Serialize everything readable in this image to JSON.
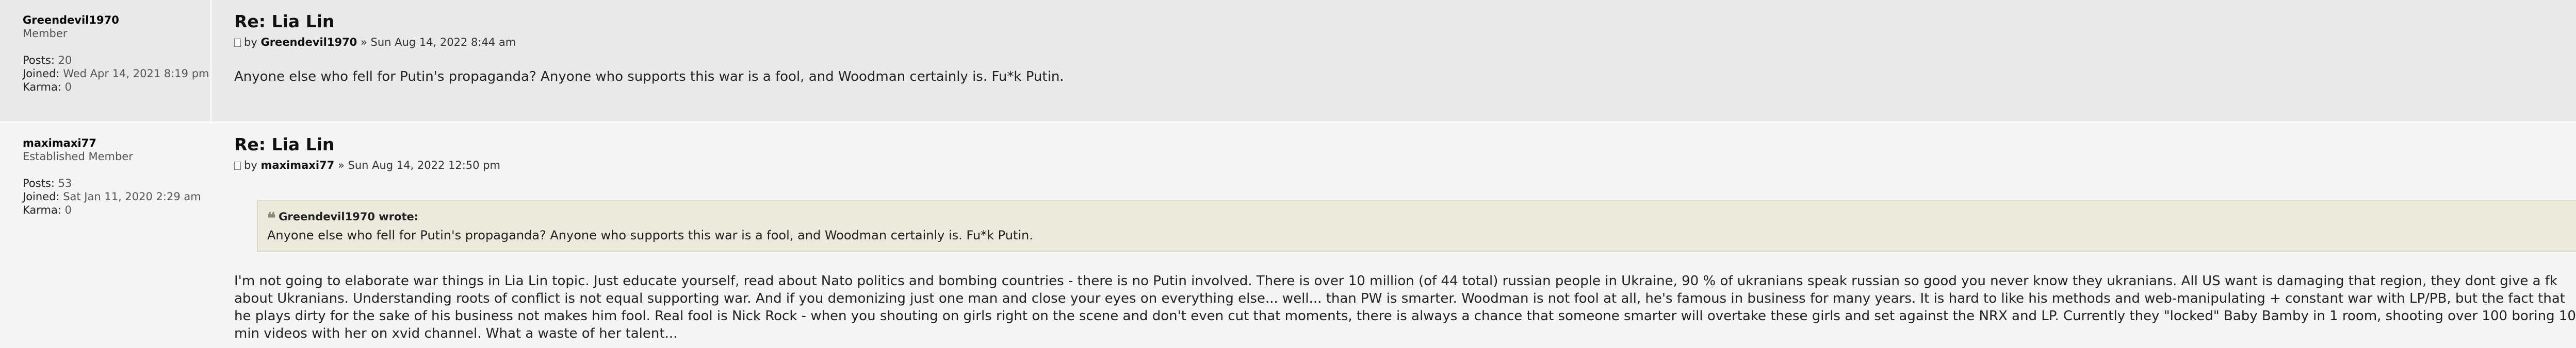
{
  "posts": [
    {
      "username": "Greendevil1970",
      "rank": "Member",
      "posts_label": "Posts:",
      "posts_value": "20",
      "joined_label": "Joined:",
      "joined_value": "Wed Apr 14, 2021 8:19 pm",
      "karma_label": "Karma:",
      "karma_value": "0",
      "subject": "Re: Lia Lin",
      "by_label": "by",
      "author": "Greendevil1970",
      "date": "» Sun Aug 14, 2022 8:44 am",
      "text": "Anyone else who fell for Putin's propaganda? Anyone who supports this war is a fool, and Woodman certainly is. Fu*k Putin."
    },
    {
      "username": "maximaxi77",
      "rank": "Established Member",
      "posts_label": "Posts:",
      "posts_value": "53",
      "joined_label": "Joined:",
      "joined_value": "Sat Jan 11, 2020 2:29 am",
      "karma_label": "Karma:",
      "karma_value": "0",
      "subject": "Re: Lia Lin",
      "by_label": "by",
      "author": "maximaxi77",
      "date": "» Sun Aug 14, 2022 12:50 pm",
      "quote_author": "Greendevil1970 wrote:",
      "quote_text": "Anyone else who fell for Putin's propaganda? Anyone who supports this war is a fool, and Woodman certainly is. Fu*k Putin.",
      "text": "I'm not going to elaborate war things in Lia Lin topic. Just educate yourself, read about Nato politics and bombing countries - there is no Putin involved. There is over 10 million (of 44 total) russian people in Ukraine, 90 % of ukranians speak russian so good you never know they ukranians. All US want is damaging that region, they dont give a fk about Ukranians. Understanding roots of conflict is not equal supporting war. And if you demonizing just one man and close your eyes on everything else... well... than PW is smarter. Woodman is not fool at all, he's famous in business for many years. It is hard to like his methods and web-manipulating + constant war with LP/PB, but the fact that he plays dirty for the sake of his business not makes him fool. Real fool is Nick Rock - when you shouting on girls right on the scene and don't even cut that moments, there is always a chance that someone smarter will overtake these girls and set against the NRX and LP. Currently they \"locked\" Baby Bamby in 1 room, shooting over 100 boring 10 min videos with her on xvid channel. What a waste of her talent..."
    }
  ]
}
